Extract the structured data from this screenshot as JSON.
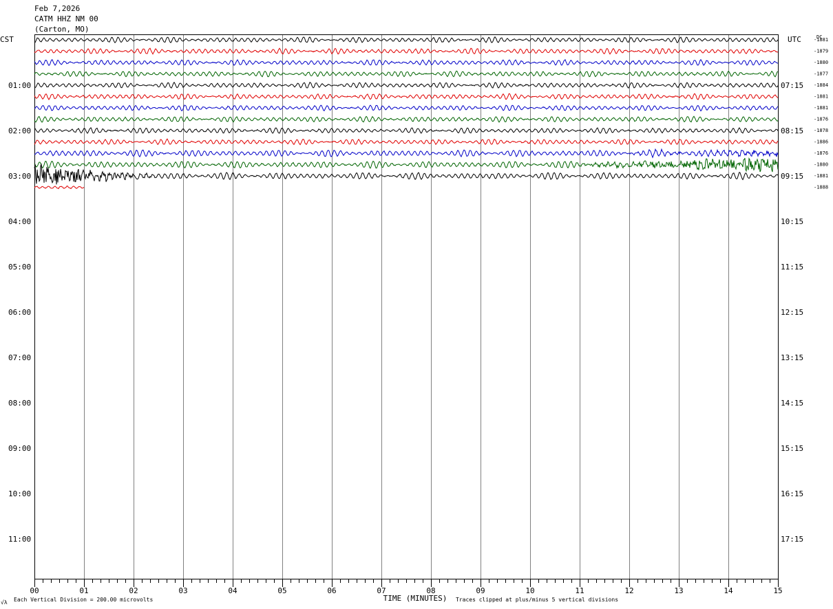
{
  "header": {
    "date": "Feb 7,2026",
    "station": "CATM HHZ NM 00",
    "location": "(Carton, MO)"
  },
  "left_zone_label": "CST",
  "right_zone_label": "UTC",
  "dc_label": "DC",
  "footer": {
    "left_note": "Each Vertical Division =  200.00 microvolts",
    "right_note": "Traces clipped at plus/minus 5 vertical divisions",
    "corner_mark": "√λ"
  },
  "colors": {
    "cycle": [
      "#000000",
      "#e00000",
      "#0000c8",
      "#006400"
    ],
    "grid": "#808080"
  },
  "chart_data": {
    "type": "line",
    "title": "",
    "xlabel": "TIME (MINUTES)",
    "ylabel": "",
    "xlim": [
      0,
      15
    ],
    "x_ticks": [
      "00",
      "01",
      "02",
      "03",
      "04",
      "05",
      "06",
      "07",
      "08",
      "09",
      "10",
      "11",
      "12",
      "13",
      "14",
      "15"
    ],
    "left_hour_labels": [
      "01:00",
      "02:00",
      "03:00",
      "04:00",
      "05:00",
      "06:00",
      "07:00",
      "08:00",
      "09:00",
      "10:00",
      "11:00"
    ],
    "right_hour_labels": [
      "07:15",
      "08:15",
      "09:15",
      "10:15",
      "11:15",
      "12:15",
      "13:15",
      "14:15",
      "15:15",
      "16:15",
      "17:15"
    ],
    "traces_per_hour": 4,
    "minutes_per_trace": 15,
    "grid": true,
    "series": [
      {
        "color": "#000000",
        "dc": "-1881",
        "minutes": 15,
        "amplitude": 4,
        "burst": "none"
      },
      {
        "color": "#e00000",
        "dc": "-1879",
        "minutes": 15,
        "amplitude": 4,
        "burst": "none"
      },
      {
        "color": "#0000c8",
        "dc": "-1880",
        "minutes": 15,
        "amplitude": 4,
        "burst": "none"
      },
      {
        "color": "#006400",
        "dc": "-1877",
        "minutes": 15,
        "amplitude": 4,
        "burst": "none"
      },
      {
        "color": "#000000",
        "dc": "-1884",
        "minutes": 15,
        "amplitude": 4,
        "burst": "none"
      },
      {
        "color": "#e00000",
        "dc": "-1881",
        "minutes": 15,
        "amplitude": 4,
        "burst": "none"
      },
      {
        "color": "#0000c8",
        "dc": "-1881",
        "minutes": 15,
        "amplitude": 4,
        "burst": "none"
      },
      {
        "color": "#006400",
        "dc": "-1876",
        "minutes": 15,
        "amplitude": 4,
        "burst": "none"
      },
      {
        "color": "#000000",
        "dc": "-1878",
        "minutes": 15,
        "amplitude": 4,
        "burst": "none"
      },
      {
        "color": "#e00000",
        "dc": "-1886",
        "minutes": 15,
        "amplitude": 4,
        "burst": "none"
      },
      {
        "color": "#0000c8",
        "dc": "-1876",
        "minutes": 15,
        "amplitude": 5,
        "burst": "end"
      },
      {
        "color": "#006400",
        "dc": "-1880",
        "minutes": 15,
        "amplitude": 5,
        "burst": "end"
      },
      {
        "color": "#000000",
        "dc": "-1881",
        "minutes": 15,
        "amplitude": 5,
        "burst": "start"
      },
      {
        "color": "#e00000",
        "dc": "-1888",
        "minutes": 1,
        "amplitude": 3,
        "burst": "none"
      }
    ]
  }
}
